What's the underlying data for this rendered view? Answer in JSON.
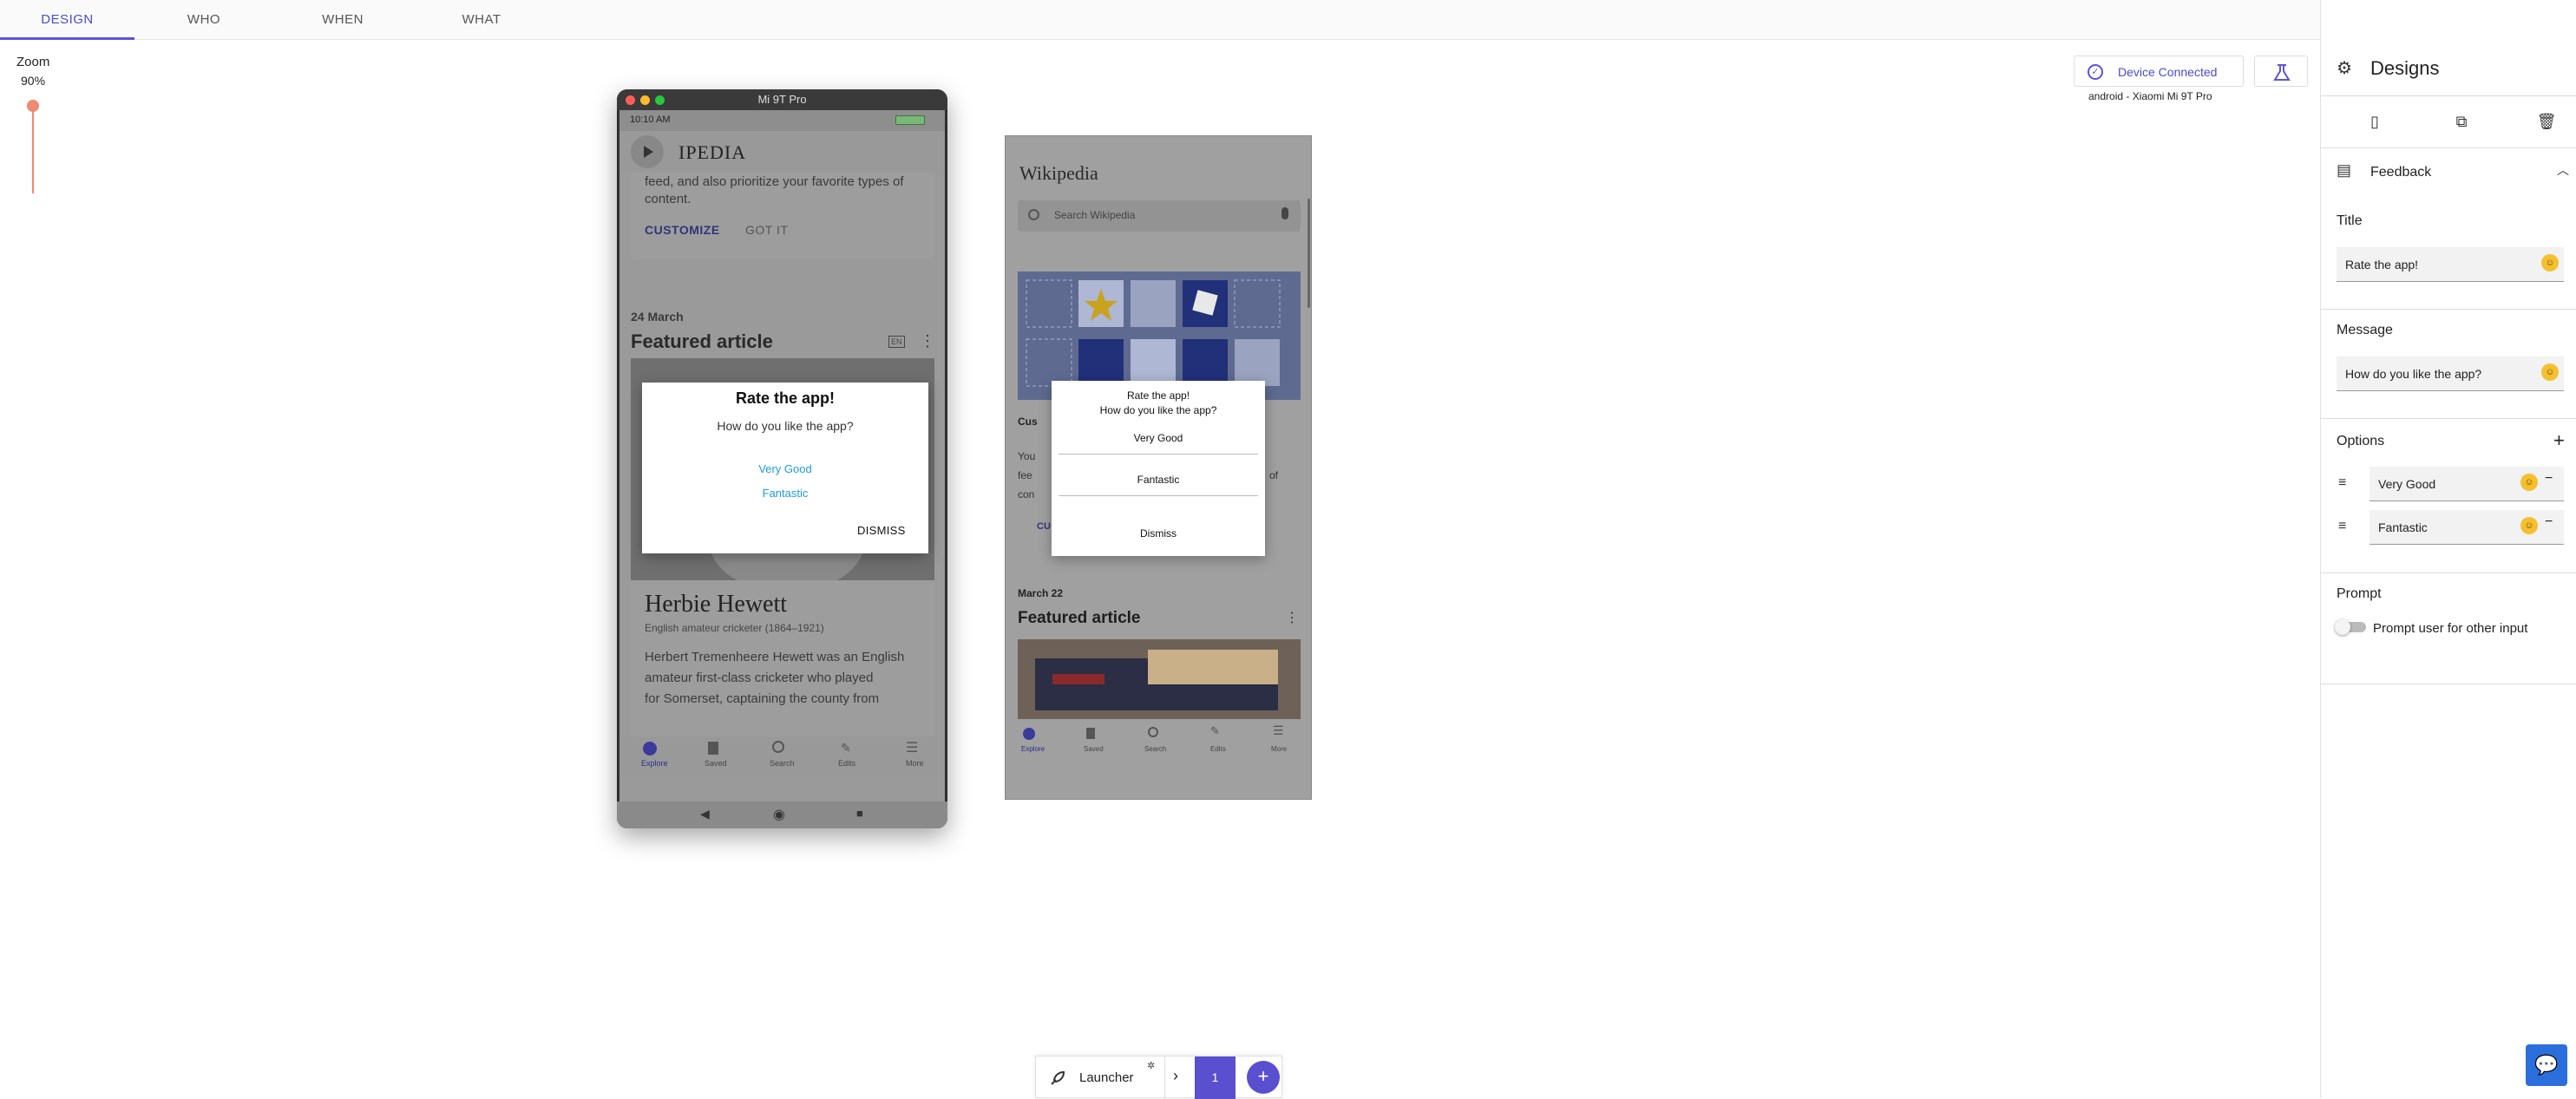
{
  "tabs": [
    "DESIGN",
    "WHO",
    "WHEN",
    "WHAT"
  ],
  "zoom": {
    "label": "Zoom",
    "value": "90%",
    "level": 0.9
  },
  "device": {
    "title": "Mi 9T Pro",
    "status_time": "10:10 AM",
    "app_title": "IPEDIA",
    "partial_text": "feed, and also prioritize your favorite types of",
    "partial_text2": "content.",
    "customize": "CUSTOMIZE",
    "got_it": "GOT IT",
    "date": "24 March",
    "featured": "Featured article",
    "lang_badge": "EN",
    "article_title": "Herbie Hewett",
    "article_subtitle": "English amateur cricketer (1864–1921)",
    "article_text": [
      "Herbert Tremenheere Hewett was an English",
      "amateur first-class cricketer who played",
      "for Somerset, captaining the county from"
    ],
    "nav": [
      "Explore",
      "Saved",
      "Search",
      "Edits",
      "More"
    ],
    "dialog": {
      "title": "Rate the app!",
      "message": "How do you like the app?",
      "options": [
        "Very Good",
        "Fantastic"
      ],
      "dismiss": "DISMISS"
    }
  },
  "preview": {
    "logo": "Wikipedia",
    "search_placeholder": "Search Wikipedia",
    "card_title_partial": "Cus",
    "card_text_partial": [
      "You",
      "fee",
      "con"
    ],
    "card_text_right": "of",
    "card_link_partial": "CU",
    "date": "March 22",
    "featured": "Featured article",
    "nav": [
      "Explore",
      "Saved",
      "Search",
      "Edits",
      "More"
    ],
    "dialog": {
      "title": "Rate the app!",
      "message": "How do you like the app?",
      "options": [
        "Very Good",
        "Fantastic"
      ],
      "dismiss": "Dismiss"
    }
  },
  "device_connection": {
    "label": "Device Connected",
    "device_info": "android - Xiaomi Mi 9T Pro"
  },
  "panel": {
    "header": "Designs",
    "section": "Feedback",
    "title_label": "Title",
    "title_value": "Rate the app!",
    "message_label": "Message",
    "message_value": "How do you like the app?",
    "options_label": "Options",
    "options": [
      "Very Good",
      "Fantastic"
    ],
    "prompt_label": "Prompt",
    "prompt_toggle_label": "Prompt user for other input"
  },
  "bottombar": {
    "launcher": "Launcher",
    "page": "1"
  },
  "colors": {
    "accent": "#5a55d6",
    "zoom": "#f08a72",
    "chat": "#2a6fdb"
  }
}
